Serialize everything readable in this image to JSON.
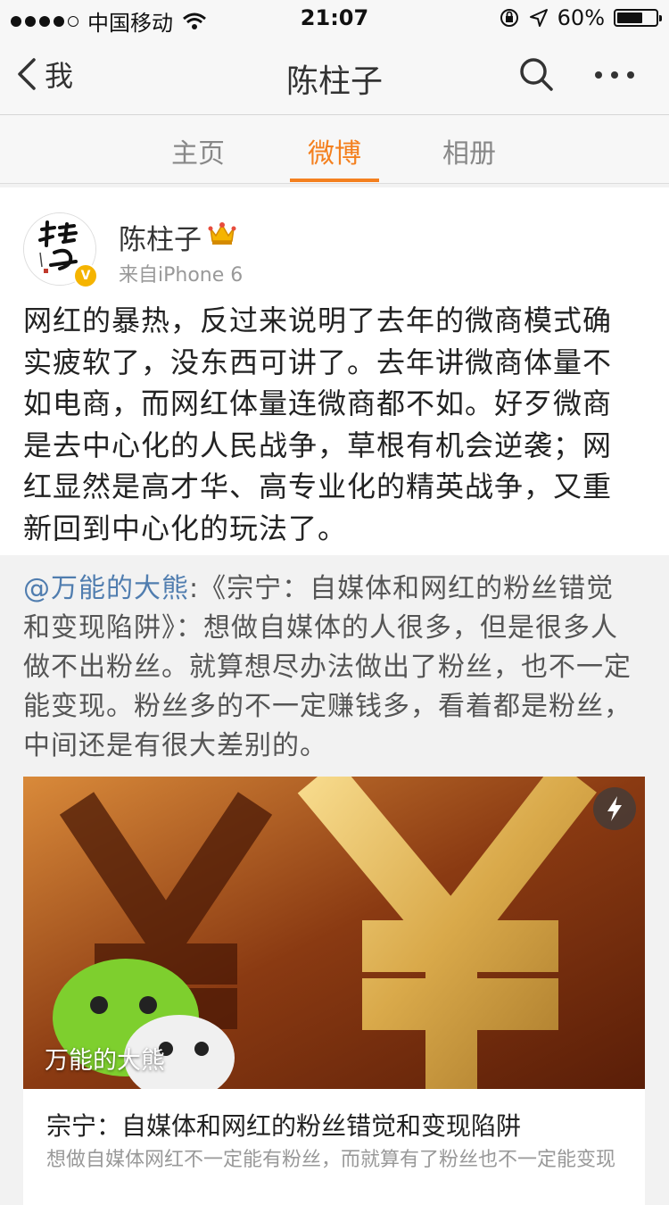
{
  "status_bar": {
    "carrier": "中国移动",
    "time": "21:07",
    "battery": "60%"
  },
  "nav": {
    "back_label": "我",
    "title": "陈柱子"
  },
  "tabs": [
    {
      "label": "主页",
      "active": false
    },
    {
      "label": "微博",
      "active": true
    },
    {
      "label": "相册",
      "active": false
    }
  ],
  "post": {
    "username": "陈柱子",
    "source": "来自iPhone 6",
    "text": "网红的暴热，反过来说明了去年的微商模式确实疲软了，没东西可讲了。去年讲微商体量不如电商，而网红体量连微商都不如。好歹微商是去中心化的人民战争，草根有机会逆袭；网红显然是高才华、高专业化的精英战争，又重新回到中心化的玩法了。",
    "repost": {
      "mention": "@万能的大熊",
      "text": ":《宗宁：自媒体和网红的粉丝错觉和变现陷阱》：想做自媒体的人很多，但是很多人做不出粉丝。就算想尽办法做出了粉丝，也不一定能变现。粉丝多的不一定赚钱多，看着都是粉丝，中间还是有很大差别的。",
      "card": {
        "image_caption": "万能的大熊",
        "title": "宗宁：自媒体和网红的粉丝错觉和变现陷阱",
        "description": "想做自媒体网红不一定能有粉丝，而就算有了粉丝也不一定能变现"
      }
    }
  },
  "colors": {
    "accent": "#f4801f",
    "link": "#507daf"
  }
}
